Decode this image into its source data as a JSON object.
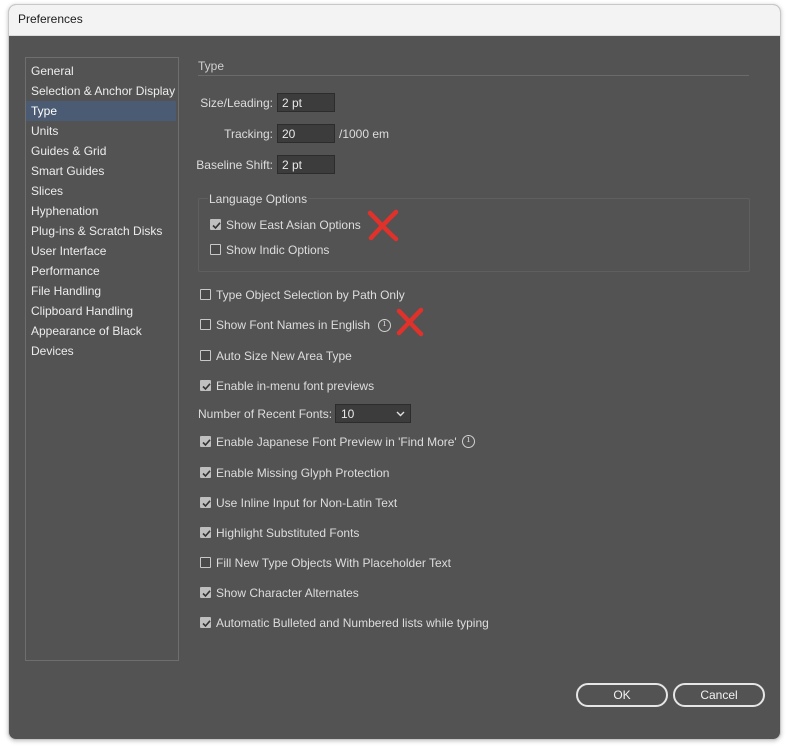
{
  "window": {
    "title": "Preferences"
  },
  "sidebar": {
    "items": [
      {
        "label": "General",
        "selected": false
      },
      {
        "label": "Selection & Anchor Display",
        "selected": false
      },
      {
        "label": "Type",
        "selected": true
      },
      {
        "label": "Units",
        "selected": false
      },
      {
        "label": "Guides & Grid",
        "selected": false
      },
      {
        "label": "Smart Guides",
        "selected": false
      },
      {
        "label": "Slices",
        "selected": false
      },
      {
        "label": "Hyphenation",
        "selected": false
      },
      {
        "label": "Plug-ins & Scratch Disks",
        "selected": false
      },
      {
        "label": "User Interface",
        "selected": false
      },
      {
        "label": "Performance",
        "selected": false
      },
      {
        "label": "File Handling",
        "selected": false
      },
      {
        "label": "Clipboard Handling",
        "selected": false
      },
      {
        "label": "Appearance of Black",
        "selected": false
      },
      {
        "label": "Devices",
        "selected": false
      }
    ]
  },
  "type_section": {
    "title": "Type",
    "size_leading": {
      "label": "Size/Leading:",
      "value": "2 pt"
    },
    "tracking": {
      "label": "Tracking:",
      "value": "20",
      "unit": "/1000 em"
    },
    "baseline_shift": {
      "label": "Baseline Shift:",
      "value": "2 pt"
    }
  },
  "language_options": {
    "title": "Language Options",
    "show_east_asian": {
      "label": "Show East Asian Options",
      "checked": true
    },
    "show_indic": {
      "label": "Show Indic Options",
      "checked": false
    }
  },
  "options": {
    "type_object_selection": {
      "label": "Type Object Selection by Path Only",
      "checked": false
    },
    "show_font_names_english": {
      "label": "Show Font Names in English",
      "checked": false
    },
    "auto_size_area_type": {
      "label": "Auto Size New Area Type",
      "checked": false
    },
    "in_menu_font_previews": {
      "label": "Enable in-menu font previews",
      "checked": true
    },
    "recent_fonts": {
      "label": "Number of Recent Fonts:",
      "value": "10"
    },
    "japanese_font_preview": {
      "label": "Enable Japanese Font Preview in 'Find More'",
      "checked": true
    },
    "missing_glyph_protection": {
      "label": "Enable Missing Glyph Protection",
      "checked": true
    },
    "inline_input": {
      "label": "Use Inline Input for Non-Latin Text",
      "checked": true
    },
    "highlight_substituted": {
      "label": "Highlight Substituted Fonts",
      "checked": true
    },
    "placeholder_text": {
      "label": "Fill New Type Objects With Placeholder Text",
      "checked": false
    },
    "character_alternates": {
      "label": "Show Character Alternates",
      "checked": true
    },
    "auto_bulleted_lists": {
      "label": "Automatic Bulleted and Numbered lists while typing",
      "checked": true
    }
  },
  "buttons": {
    "ok": "OK",
    "cancel": "Cancel"
  },
  "colors": {
    "panel_bg": "#535353",
    "selection": "#4b5b73",
    "annotation_red": "#e0312a"
  },
  "icons": [
    "info-icon",
    "checkmark-icon",
    "chevron-down-icon",
    "red-x-mark"
  ]
}
